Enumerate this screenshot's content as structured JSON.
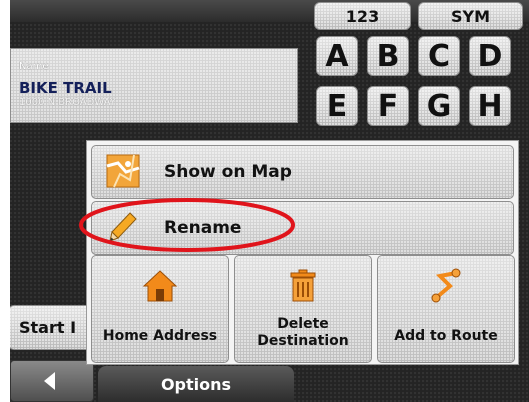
{
  "keyboard": {
    "mode_numbers": "123",
    "mode_symbols": "SYM",
    "keys": [
      "A",
      "B",
      "C",
      "D",
      "E",
      "F",
      "G",
      "H"
    ]
  },
  "name_panel": {
    "label": "Name",
    "title": "BIKE TRAIL",
    "subtitle": "1000 N BROADWAY"
  },
  "left_buttons": {
    "start": "Start I"
  },
  "menu": {
    "show_on_map": "Show on Map",
    "rename": "Rename",
    "home_address": "Home Address",
    "delete_line1": "Delete",
    "delete_line2": "Destination",
    "add_to_route": "Add to Route"
  },
  "bottom_tab": {
    "options": "Options"
  },
  "icons": {
    "back": "back-arrow-icon",
    "show_on_map": "map-icon",
    "rename": "pencil-icon",
    "home": "house-icon",
    "delete": "trash-icon",
    "route": "route-icon"
  },
  "colors": {
    "highlight_ring": "#e0141b",
    "title_text": "#14205a",
    "background": "#242424"
  }
}
